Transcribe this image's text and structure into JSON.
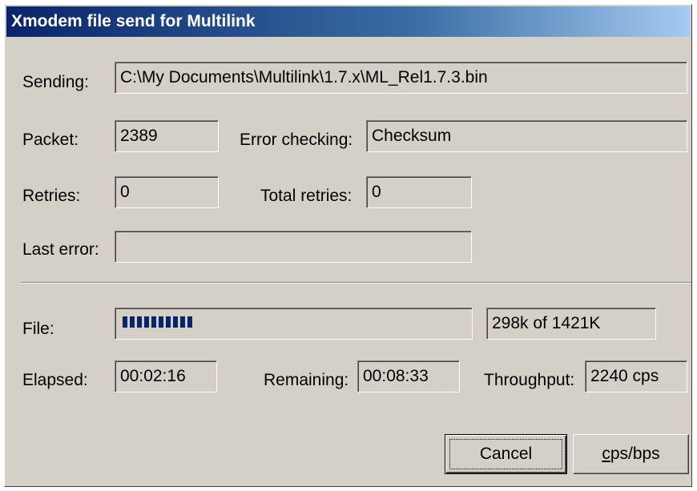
{
  "window": {
    "title": "Xmodem file send for Multilink"
  },
  "sending": {
    "label": "Sending:",
    "value": "C:\\My Documents\\Multilink\\1.7.x\\ML_Rel1.7.3.bin"
  },
  "packet": {
    "label": "Packet:",
    "value": "2389"
  },
  "error_checking": {
    "label": "Error checking:",
    "value": "Checksum"
  },
  "retries": {
    "label": "Retries:",
    "value": "0"
  },
  "total_retries": {
    "label": "Total retries:",
    "value": "0"
  },
  "last_error": {
    "label": "Last error:",
    "value": ""
  },
  "file": {
    "label": "File:",
    "progress_fraction": 0.21,
    "size_text": "298k of 1421K"
  },
  "elapsed": {
    "label": "Elapsed:",
    "value": "00:02:16"
  },
  "remaining": {
    "label": "Remaining:",
    "value": "00:08:33"
  },
  "throughput": {
    "label": "Throughput:",
    "value": "2240 cps"
  },
  "buttons": {
    "cancel": "Cancel",
    "cps_bps_accel": "c",
    "cps_bps_rest": "ps/bps"
  },
  "colors": {
    "titlebar_start": "#0a246a",
    "titlebar_end": "#a6caf0",
    "progress": "#0a246a",
    "face": "#d4d0c8"
  }
}
